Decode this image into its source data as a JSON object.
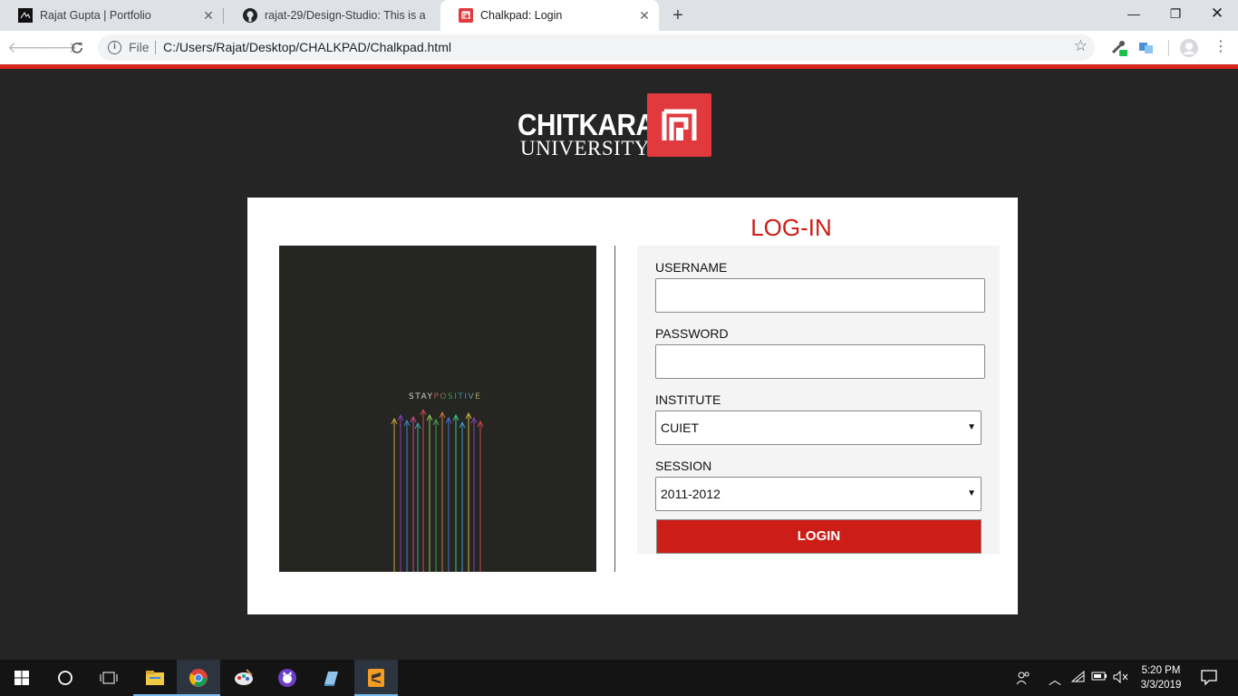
{
  "browser": {
    "tabs": [
      {
        "title": "Rajat Gupta | Portfolio",
        "icon": "portfolio-favicon"
      },
      {
        "title": "rajat-29/Design-Studio: This is a",
        "icon": "github-icon"
      },
      {
        "title": "Chalkpad: Login",
        "icon": "chalkpad-favicon",
        "active": true
      }
    ],
    "address": {
      "scheme_label": "File",
      "url": "C:/Users/Rajat/Desktop/CHALKPAD/Chalkpad.html"
    }
  },
  "page": {
    "logo": {
      "line1": "CHITKARA",
      "line2": "UNIVERSITY"
    },
    "poster": {
      "text_part1": "STAY",
      "text_part2": "POSITIVE"
    },
    "login": {
      "title": "LOG-IN",
      "username_label": "USERNAME",
      "username_value": "",
      "password_label": "PASSWORD",
      "password_value": "",
      "institute_label": "INSTITUTE",
      "institute_selected": "CUIET",
      "session_label": "SESSION",
      "session_selected": "2011-2012",
      "button_label": "LOGIN"
    }
  },
  "taskbar": {
    "time": "5:20 PM",
    "date": "3/3/2019"
  },
  "colors": {
    "accent": "#cc1d17",
    "page_bg": "#252525",
    "logo_red": "#e03a3e"
  }
}
